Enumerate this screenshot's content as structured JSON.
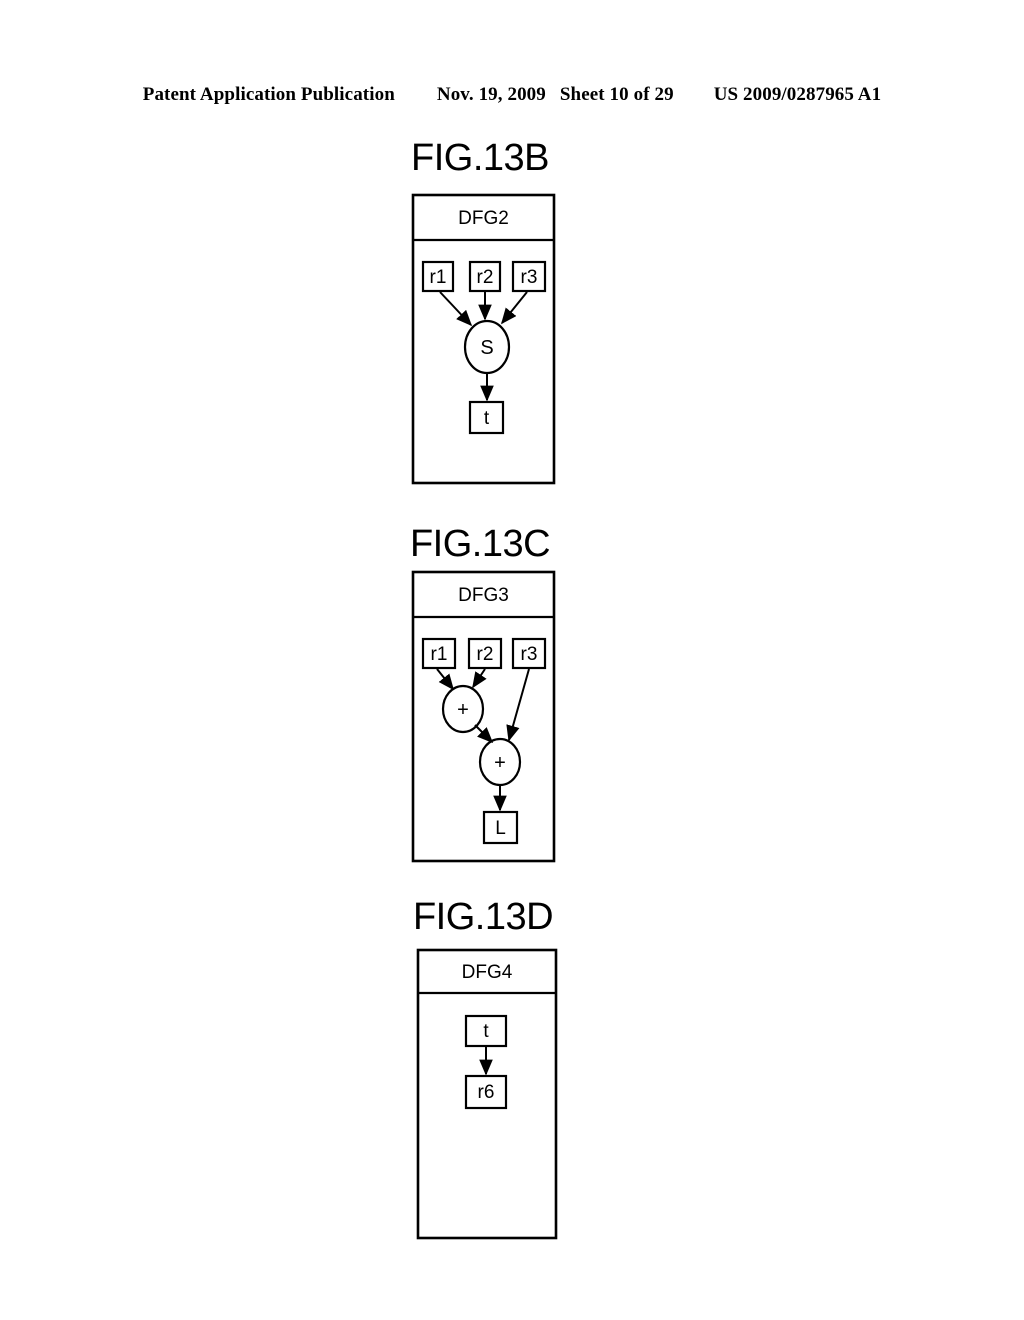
{
  "header": {
    "publication": "Patent Application Publication",
    "date": "Nov. 19, 2009",
    "sheet": "Sheet 10 of 29",
    "patent_number": "US 2009/0287965 A1"
  },
  "figures": [
    {
      "title": "FIG.13B",
      "panel_label": "DFG2",
      "nodes": [
        {
          "id": "r1",
          "label": "r1",
          "shape": "rect"
        },
        {
          "id": "r2",
          "label": "r2",
          "shape": "rect"
        },
        {
          "id": "r3",
          "label": "r3",
          "shape": "rect"
        },
        {
          "id": "s",
          "label": "S",
          "shape": "ellipse"
        },
        {
          "id": "t",
          "label": "t",
          "shape": "rect"
        }
      ],
      "edges": [
        {
          "from": "r1",
          "to": "s"
        },
        {
          "from": "r2",
          "to": "s"
        },
        {
          "from": "r3",
          "to": "s"
        },
        {
          "from": "s",
          "to": "t"
        }
      ]
    },
    {
      "title": "FIG.13C",
      "panel_label": "DFG3",
      "nodes": [
        {
          "id": "r1",
          "label": "r1",
          "shape": "rect"
        },
        {
          "id": "r2",
          "label": "r2",
          "shape": "rect"
        },
        {
          "id": "r3",
          "label": "r3",
          "shape": "rect"
        },
        {
          "id": "add1",
          "label": "+",
          "shape": "ellipse"
        },
        {
          "id": "add2",
          "label": "+",
          "shape": "ellipse"
        },
        {
          "id": "L",
          "label": "L",
          "shape": "rect"
        }
      ],
      "edges": [
        {
          "from": "r1",
          "to": "add1"
        },
        {
          "from": "r2",
          "to": "add1"
        },
        {
          "from": "add1",
          "to": "add2"
        },
        {
          "from": "r3",
          "to": "add2"
        },
        {
          "from": "add2",
          "to": "L"
        }
      ]
    },
    {
      "title": "FIG.13D",
      "panel_label": "DFG4",
      "nodes": [
        {
          "id": "t",
          "label": "t",
          "shape": "rect"
        },
        {
          "id": "r6",
          "label": "r6",
          "shape": "rect"
        }
      ],
      "edges": [
        {
          "from": "t",
          "to": "r6"
        }
      ]
    }
  ]
}
